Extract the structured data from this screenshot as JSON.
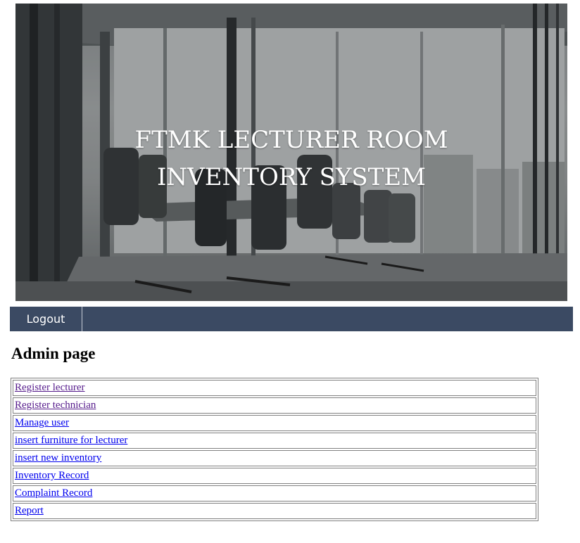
{
  "banner": {
    "title_line1": "FTMK LECTURER ROOM",
    "title_line2": "INVENTORY SYSTEM"
  },
  "nav": {
    "logout_label": "Logout"
  },
  "page": {
    "heading": "Admin page"
  },
  "menu": {
    "items": [
      {
        "label": "Register lecturer",
        "visited": true
      },
      {
        "label": "Register technician",
        "visited": true
      },
      {
        "label": "Manage user",
        "visited": false
      },
      {
        "label": "insert furniture for lecturer",
        "visited": false
      },
      {
        "label": "insert new inventory",
        "visited": false
      },
      {
        "label": "Inventory Record",
        "visited": false
      },
      {
        "label": "Complaint Record",
        "visited": false
      },
      {
        "label": "Report",
        "visited": false
      }
    ]
  },
  "colors": {
    "navbar_bg": "#3b4a63",
    "link": "#0000ee",
    "link_visited": "#551a8b"
  }
}
